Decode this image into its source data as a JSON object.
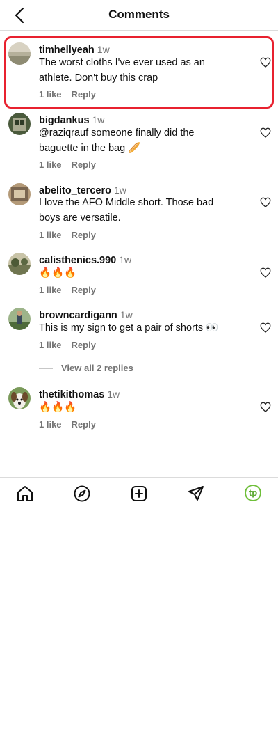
{
  "header": {
    "title": "Comments",
    "back_icon": "chevron-left-icon"
  },
  "comments": [
    {
      "username": "timhellyeah",
      "time": "1w",
      "text": "The worst cloths I've ever used as an athlete. Don't buy this crap",
      "likes": "1 like",
      "reply": "Reply"
    },
    {
      "username": "bigdankus",
      "time": "1w",
      "text": "@raziqrauf someone finally did the baguette in the bag 🥖",
      "likes": "1 like",
      "reply": "Reply"
    },
    {
      "username": "abelito_tercero",
      "time": "1w",
      "text": "I love the AFO Middle short. Those bad boys are versatile.",
      "likes": "1 like",
      "reply": "Reply"
    },
    {
      "username": "calisthenics.990",
      "time": "1w",
      "text": "🔥🔥🔥",
      "likes": "1 like",
      "reply": "Reply"
    },
    {
      "username": "browncardigann",
      "time": "1w",
      "text": "This is my sign to get a pair of shorts 👀",
      "likes": "1 like",
      "reply": "Reply"
    },
    {
      "username": "thetikithomas",
      "time": "1w",
      "text": "🔥🔥🔥",
      "likes": "1 like",
      "reply": "Reply"
    }
  ],
  "view_replies": "View all 2 replies",
  "nav": {
    "items": [
      "home-icon",
      "explore-icon",
      "create-icon",
      "direct-message-icon"
    ],
    "profile_initials": "tp"
  },
  "colors": {
    "highlight": "#e8212f",
    "profile_ring": "#6fbf3a",
    "muted": "#737373"
  }
}
